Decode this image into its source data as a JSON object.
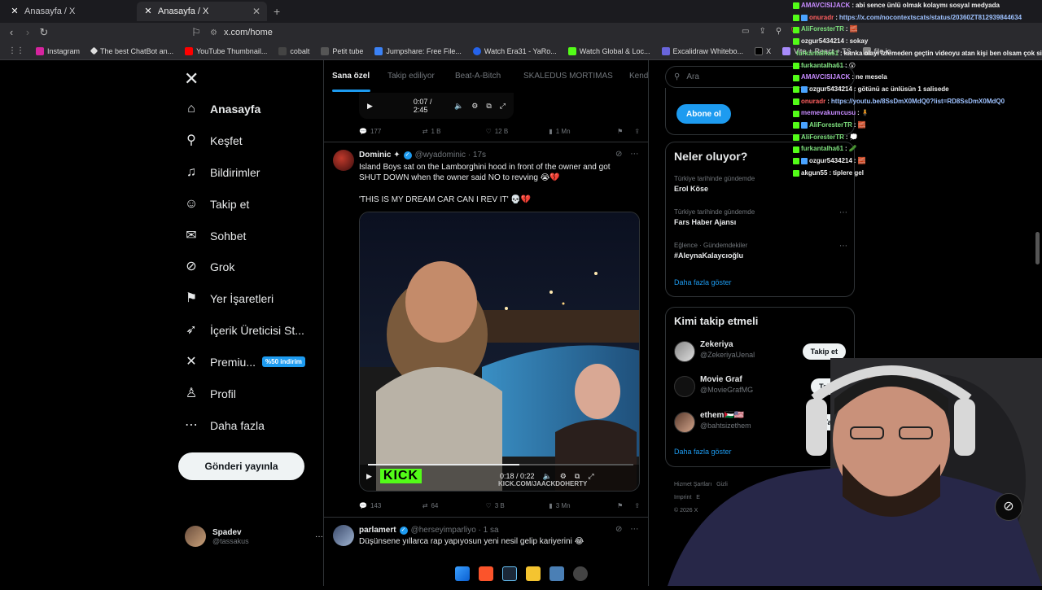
{
  "browser": {
    "tabs": [
      {
        "title": "Anasayfa / X",
        "active": false
      },
      {
        "title": "Anasayfa / X",
        "active": true
      }
    ],
    "url": "x.com/home",
    "bookmarks": [
      "Instagram",
      "The best ChatBot an...",
      "YouTube Thumbnail...",
      "cobalt",
      "Petit tube",
      "Jumpshare: Free File...",
      "Watch Era31 - YaRo...",
      "Watch Global & Loc...",
      "Excalidraw Whitebo...",
      "X",
      "Vite + React + TS",
      "file.io"
    ]
  },
  "nav": {
    "items": [
      {
        "label": "Anasayfa",
        "icon": "home-icon",
        "glyph": "⌂"
      },
      {
        "label": "Keşfet",
        "icon": "search-icon",
        "glyph": "⚲"
      },
      {
        "label": "Bildirimler",
        "icon": "bell-icon",
        "glyph": "♫"
      },
      {
        "label": "Takip et",
        "icon": "follow-user-icon",
        "glyph": "☺"
      },
      {
        "label": "Sohbet",
        "icon": "envelope-icon",
        "glyph": "✉"
      },
      {
        "label": "Grok",
        "icon": "grok-icon",
        "glyph": "⊘"
      },
      {
        "label": "Yer İşaretleri",
        "icon": "bookmark-icon",
        "glyph": "⚑"
      },
      {
        "label": "İçerik Üreticisi St...",
        "icon": "rocket-icon",
        "glyph": "➶"
      },
      {
        "label": "Premiu...",
        "icon": "x-premium-icon",
        "glyph": "✕"
      },
      {
        "label": "Profil",
        "icon": "profile-icon",
        "glyph": "♙"
      },
      {
        "label": "Daha fazla",
        "icon": "more-circle-icon",
        "glyph": "⋯"
      }
    ],
    "premium_badge": "%50 indirim",
    "post_button": "Gönderi yayınla",
    "account": {
      "name": "Spadev",
      "handle": "@tassakus",
      "more": "···"
    }
  },
  "feed": {
    "tabs": [
      "Sana özel",
      "Takip ediliyor",
      "Beat-A-Bitch",
      "SKALEDUS MORTIMAS",
      "Kend"
    ],
    "top_video_time": "0:07 / 2:45",
    "top_metrics": {
      "replies": "177",
      "reposts": "1 B",
      "likes": "12 B",
      "views": "1 Mn"
    },
    "tweet1": {
      "name": "Dominic ✦",
      "handle": "@wyadominic · 17s",
      "text1": "Island Boys sat on the Lamborghini hood in front of the owner and got SHUT DOWN when the owner said NO to revving 😭💔",
      "text2": "'THIS IS MY DREAM CAR CAN I REV IT' 💀💔",
      "video_time": "0:18 / 0:22",
      "kick_label": "KICK",
      "watermark": "KICK.COM/JAACKDOHERTY",
      "metrics": {
        "replies": "143",
        "reposts": "64",
        "likes": "3 B",
        "views": "3 Mn"
      }
    },
    "tweet2": {
      "name": "parlamert",
      "handle": "@herseyimparliyo · 1 sa",
      "text": "Düşünsene yıllarca rap yapıyosun yeni nesil gelip kariyerini 😂"
    }
  },
  "sidebar": {
    "search_placeholder": "Ara",
    "subscribe_button": "Abone ol",
    "trends_title": "Neler oluyor?",
    "trends": [
      {
        "meta": "Türkiye tarihinde gündemde",
        "title": "Erol Köse"
      },
      {
        "meta": "Türkiye tarihinde gündemde",
        "title": "Fars Haber Ajansı"
      },
      {
        "meta": "Eğlence · Gündemdekiler",
        "title": "#AleynaKalaycıoğlu"
      }
    ],
    "trends_more": "Daha fazla göster",
    "follow_title": "Kimi takip etmeli",
    "follow": [
      {
        "name": "Zekeriya",
        "handle": "@ZekeriyaUenal",
        "button": "Takip et"
      },
      {
        "name": "Movie Graf",
        "handle": "@MovieGrafMG",
        "button": "Takip"
      },
      {
        "name": "ethem🇵🇸🇺🇸",
        "handle": "@bahtsizethem",
        "button": "Taki"
      }
    ],
    "follow_more": "Daha fazla göster",
    "footer": [
      "Hizmet Şartları",
      "Gizli",
      "Imprint",
      "E",
      "© 2026 X"
    ]
  },
  "chat": [
    {
      "user": "AMAVCISIJACK",
      "cls": "purple",
      "msg": "abi sence ünlü olmak kolaymı sosyal medyada",
      "link": false
    },
    {
      "user": "onuradr",
      "cls": "red",
      "msg": "https://x.com/nocontextscats/status/20360ZT812939844634",
      "link": true
    },
    {
      "user": "AliForesterTR",
      "cls": "green2",
      "msg": "🧱",
      "link": false
    },
    {
      "user": "ozgur5434214",
      "cls": "white",
      "msg": "sokay",
      "link": false
    },
    {
      "user": "furkantalha61",
      "cls": "green2",
      "msg": "kanka olayı izlemeden geçtin videoyu atan kişi ben olsam çok sinirlenirdim",
      "link": false
    },
    {
      "user": "furkantalha61",
      "cls": "green2",
      "msg": "😮",
      "link": false
    },
    {
      "user": "AMAVCISIJACK",
      "cls": "purple",
      "msg": "ne mesela",
      "link": false
    },
    {
      "user": "ozgur5434214",
      "cls": "white",
      "msg": "götünü ac ünlüsün 1 salisede",
      "link": false
    },
    {
      "user": "onuradr",
      "cls": "red",
      "msg": "https://youtu.be/8SsDmX0MdQ0?list=RD8SsDmX0MdQ0",
      "link": true
    },
    {
      "user": "memevakumcusu",
      "cls": "purple",
      "msg": "🧍",
      "link": false
    },
    {
      "user": "AliForesterTR",
      "cls": "green2",
      "msg": "🧱",
      "link": false
    },
    {
      "user": "AliForesterTR",
      "cls": "green2",
      "msg": "💭",
      "link": false
    },
    {
      "user": "furkantalha61",
      "cls": "green2",
      "msg": "🥒",
      "link": false
    },
    {
      "user": "ozgur5434214",
      "cls": "white",
      "msg": "🧱",
      "link": false
    },
    {
      "user": "akgun55",
      "cls": "white",
      "msg": "tiplere gel",
      "link": false
    }
  ]
}
